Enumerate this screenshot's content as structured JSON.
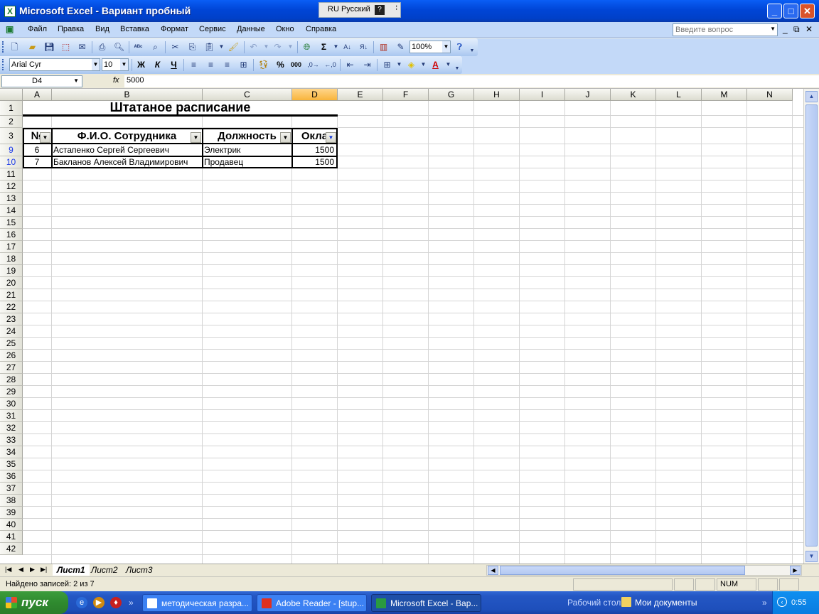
{
  "window": {
    "title": "Microsoft Excel - Вариант пробный",
    "lang": "RU Русский"
  },
  "menu": {
    "items": [
      {
        "label": "Файл"
      },
      {
        "label": "Правка"
      },
      {
        "label": "Вид"
      },
      {
        "label": "Вставка"
      },
      {
        "label": "Формат"
      },
      {
        "label": "Сервис"
      },
      {
        "label": "Данные"
      },
      {
        "label": "Окно"
      },
      {
        "label": "Справка"
      }
    ],
    "help_placeholder": "Введите вопрос"
  },
  "toolbar": {
    "zoom": "100%",
    "font": "Arial Cyr",
    "size": "10",
    "bold": "Ж",
    "italic": "К",
    "underline": "Ч",
    "sum": "Σ",
    "percent": "%",
    "thousands": "000"
  },
  "formula": {
    "name_box": "D4",
    "fx": "fx",
    "value": "5000"
  },
  "grid": {
    "columns": [
      "A",
      "B",
      "C",
      "D",
      "E",
      "F",
      "G",
      "H",
      "I",
      "J",
      "K",
      "L",
      "M",
      "N"
    ],
    "rows": [
      "1",
      "2",
      "3",
      "9",
      "10",
      "11",
      "12",
      "13",
      "14",
      "15",
      "16",
      "17",
      "18",
      "19",
      "20",
      "21",
      "22",
      "23",
      "24",
      "25",
      "26",
      "27",
      "28",
      "29",
      "30",
      "31",
      "32",
      "33",
      "34",
      "35",
      "36",
      "37",
      "38",
      "39",
      "40",
      "41",
      "42"
    ],
    "title": "Штатаное расписание",
    "headers": {
      "a": "№",
      "b": "Ф.И.О. Сотрудника",
      "c": "Должность",
      "d": "Окла"
    },
    "records": [
      {
        "num": "6",
        "name": "Астапенко Сергей Сергеевич",
        "position": "Электрик",
        "salary": "1500"
      },
      {
        "num": "7",
        "name": "Бакланов Алексей Владимирович",
        "position": "Продавец",
        "salary": "1500"
      }
    ]
  },
  "sheets": {
    "tabs": [
      "Лист1",
      "Лист2",
      "Лист3"
    ],
    "active": "Лист1"
  },
  "status": {
    "text": "Найдено записей: 2 из 7",
    "num": "NUM"
  },
  "taskbar": {
    "start": "пуск",
    "tasks": [
      {
        "label": "методическая разра..."
      },
      {
        "label": "Adobe Reader - [stup..."
      },
      {
        "label": "Microsoft Excel - Вар..."
      }
    ],
    "desktop": "Рабочий стол",
    "docs": "Мои документы",
    "clock": "0:55"
  },
  "colors": {
    "title_blue": "#0045d6",
    "selected_col": "#f8b43c",
    "filtered_row": "#1c3ae8",
    "start_green": "#2f8a2f"
  }
}
